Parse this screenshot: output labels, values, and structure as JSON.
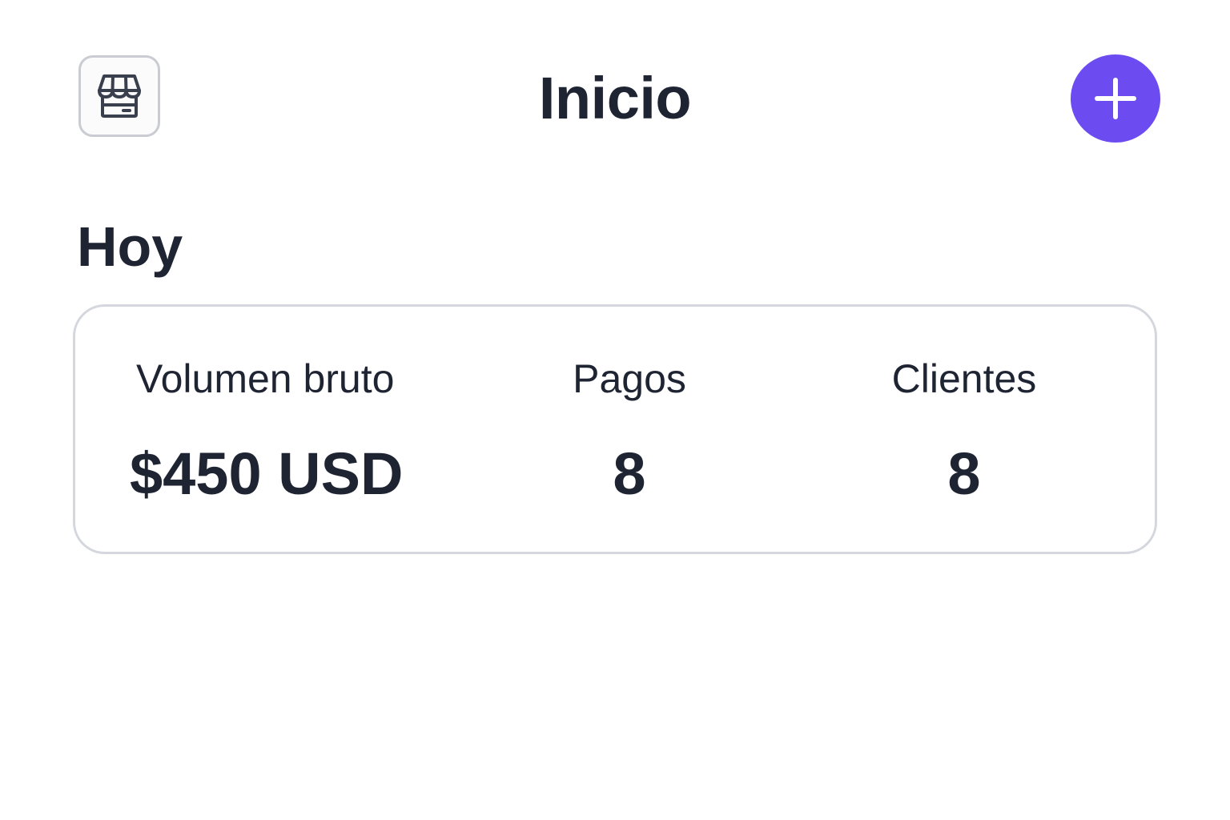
{
  "header": {
    "title": "Inicio",
    "store_icon": "storefront-icon",
    "add_icon": "plus-icon",
    "accent_color": "#6c4cf0"
  },
  "today": {
    "heading": "Hoy",
    "stats": {
      "volume": {
        "label": "Volumen bruto",
        "value": "$450 USD"
      },
      "payments": {
        "label": "Pagos",
        "value": "8"
      },
      "customers": {
        "label": "Clientes",
        "value": "8"
      }
    }
  }
}
